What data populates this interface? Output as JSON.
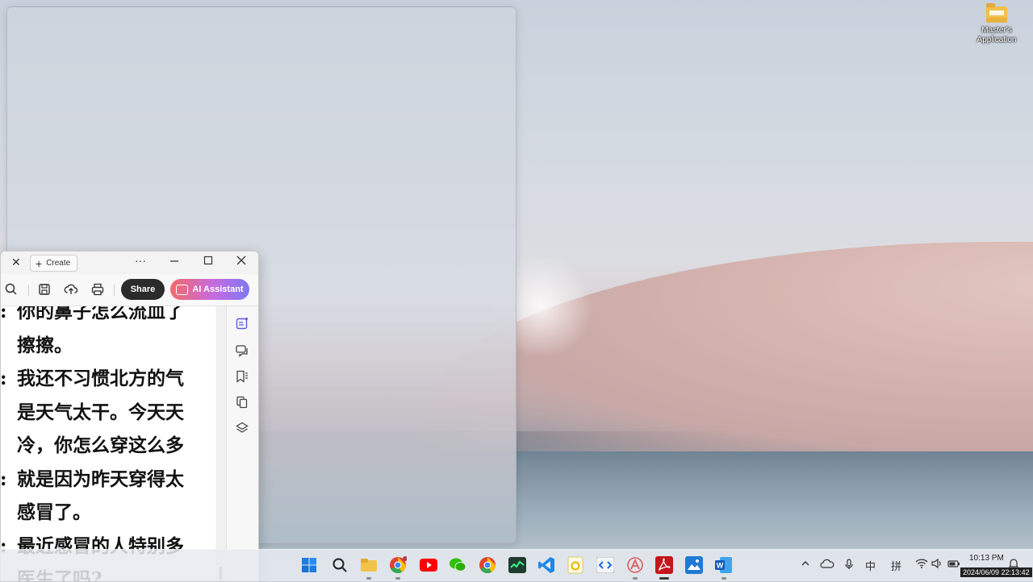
{
  "desktop": {
    "icon_label": "Master's Application"
  },
  "pdf_window": {
    "create_label": "Create",
    "more_label": "···",
    "share_label": "Share",
    "ai_label": "AI Assistant",
    "lines": [
      {
        "colon": ":",
        "text": "你的鼻子怎么流血了"
      },
      {
        "colon": "",
        "text": "擦擦。"
      },
      {
        "colon": ":",
        "text": "我还不习惯北方的气"
      },
      {
        "colon": "",
        "text": "是天气太干。今天天"
      },
      {
        "colon": "",
        "text": "冷，你怎么穿这么多"
      },
      {
        "colon": ":",
        "text": "就是因为昨天穿得太"
      },
      {
        "colon": "",
        "text": "感冒了。"
      },
      {
        "colon": ":",
        "text": "最近感冒的人特别多"
      },
      {
        "colon": "",
        "text": "医生了吗?"
      }
    ]
  },
  "taskbar": {
    "ime_mode": "中",
    "ime_name": "拼",
    "time": "10:13 PM",
    "date": "2024/06/09 22:13:42"
  }
}
